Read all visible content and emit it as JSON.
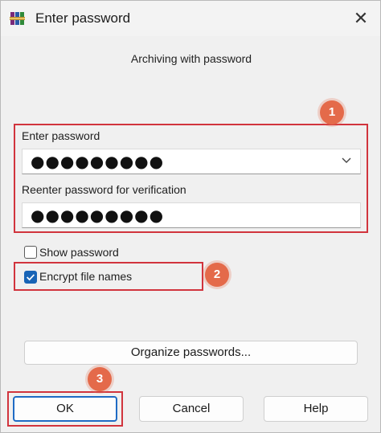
{
  "window": {
    "title": "Enter password",
    "subtitle": "Archiving with password"
  },
  "form": {
    "password_label": "Enter password",
    "password_value": "●●●●●●●●●",
    "reenter_label": "Reenter password for verification",
    "reenter_value": "●●●●●●●●●",
    "show_password_label": "Show password",
    "show_password_checked": false,
    "encrypt_names_label": "Encrypt file names",
    "encrypt_names_checked": true
  },
  "buttons": {
    "organize": "Organize passwords...",
    "ok": "OK",
    "cancel": "Cancel",
    "help": "Help"
  },
  "badges": {
    "one": "1",
    "two": "2",
    "three": "3"
  },
  "colors": {
    "highlight": "#d1343d",
    "badge": "#e46a4a",
    "accent": "#1864b6"
  },
  "icons": {
    "app": "winrar-books-icon",
    "close": "close-icon",
    "dropdown": "chevron-down-icon",
    "check": "checkmark-icon"
  }
}
